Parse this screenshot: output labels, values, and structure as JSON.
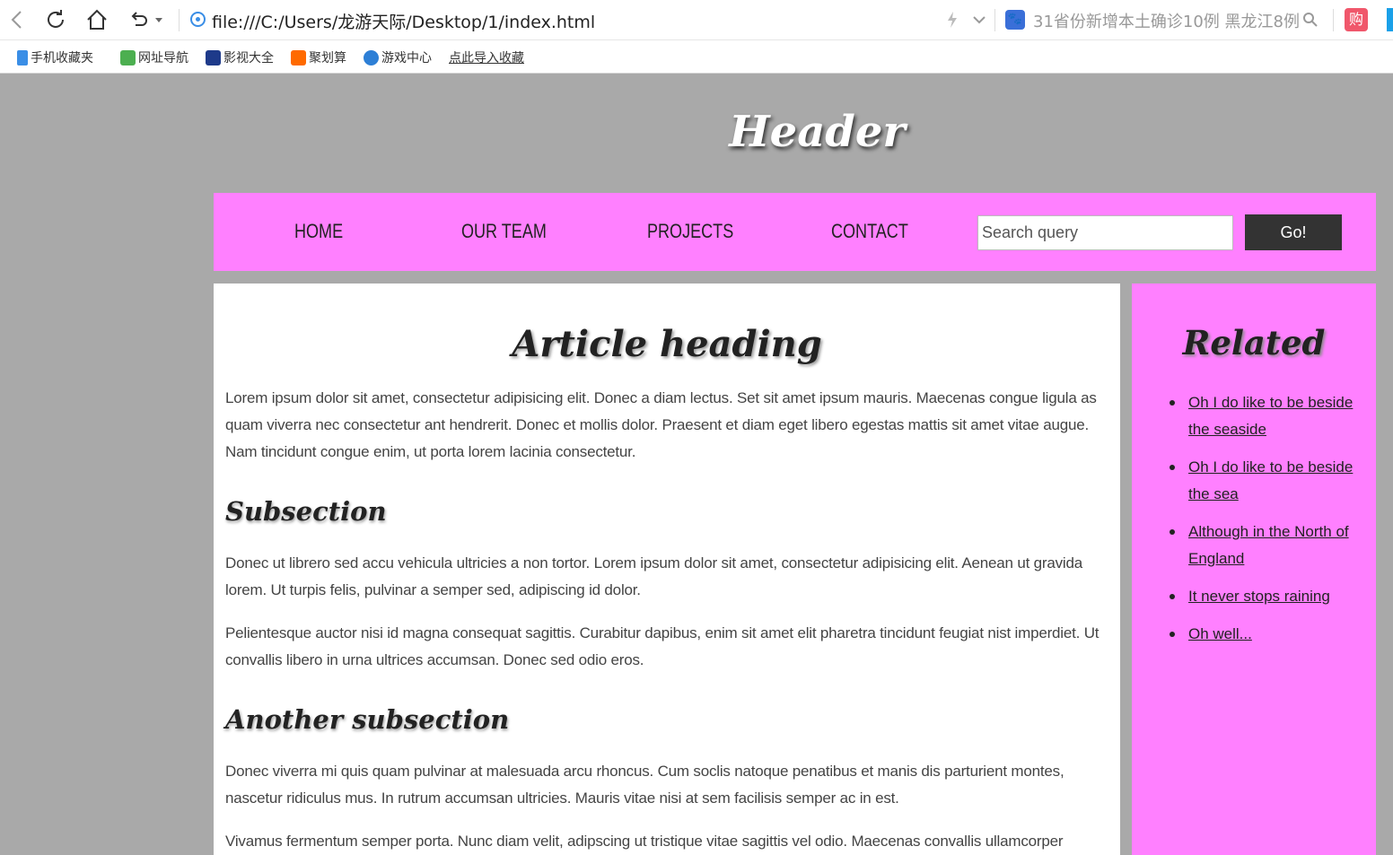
{
  "browser": {
    "url": "file:///C:/Users/龙游天际/Desktop/1/index.html",
    "news_ticker": "31省份新增本土确诊10例 黑龙江8例",
    "shop_badge": "购",
    "bookmarks": [
      {
        "label": "手机收藏夹",
        "icon": "phone-icon",
        "color": "#3a8ee6"
      },
      {
        "label": "网址导航",
        "icon": "nav-2345-icon",
        "color": "#4caf50"
      },
      {
        "label": "影视大全",
        "icon": "video-icon",
        "color": "#1e3a8a"
      },
      {
        "label": "聚划算",
        "icon": "taobao-icon",
        "color": "#ff6a00"
      },
      {
        "label": "游戏中心",
        "icon": "game-icon",
        "color": "#2d7fd6"
      },
      {
        "label": "点此导入收藏",
        "icon": "",
        "color": ""
      }
    ]
  },
  "page": {
    "title": "Header",
    "nav": {
      "links": [
        "HOME",
        "OUR TEAM",
        "PROJECTS",
        "CONTACT"
      ],
      "search_placeholder": "Search query",
      "go_label": "Go!"
    },
    "article": {
      "heading": "Article heading",
      "intro": "Lorem ipsum dolor sit amet, consectetur adipisicing elit. Donec a diam lectus. Set sit amet ipsum mauris. Maecenas congue ligula as quam viverra nec consectetur ant hendrerit. Donec et mollis dolor. Praesent et diam eget libero egestas mattis sit amet vitae augue. Nam tincidunt congue enim, ut porta lorem lacinia consectetur.",
      "subsection_heading": "Subsection",
      "subsection_p1": "Donec ut librero sed accu vehicula ultricies a non tortor. Lorem ipsum dolor sit amet, consectetur adipisicing elit. Aenean ut gravida lorem. Ut turpis felis, pulvinar a semper sed, adipiscing id dolor.",
      "subsection_p2": "Pelientesque auctor nisi id magna consequat sagittis. Curabitur dapibus, enim sit amet elit pharetra tincidunt feugiat nist imperdiet. Ut convallis libero in urna ultrices accumsan. Donec sed odio eros.",
      "another_heading": "Another subsection",
      "another_p1": "Donec viverra mi quis quam pulvinar at malesuada arcu rhoncus. Cum soclis natoque penatibus et manis dis parturient montes, nascetur ridiculus mus. In rutrum accumsan ultricies. Mauris vitae nisi at sem facilisis semper ac in est.",
      "another_p2": "Vivamus fermentum semper porta. Nunc diam velit, adipscing ut tristique vitae sagittis vel odio. Maecenas convallis ullamcorper ultricied. Curabitur"
    },
    "aside": {
      "heading": "Related",
      "links": [
        "Oh I do like to be beside the seaside",
        "Oh I do like to be beside the sea",
        "Although in the North of England",
        "It never stops raining",
        "Oh well..."
      ]
    }
  },
  "colors": {
    "background": "#a9a9a9",
    "accent_pink": "#ff80ff",
    "button_dark": "#333333"
  }
}
